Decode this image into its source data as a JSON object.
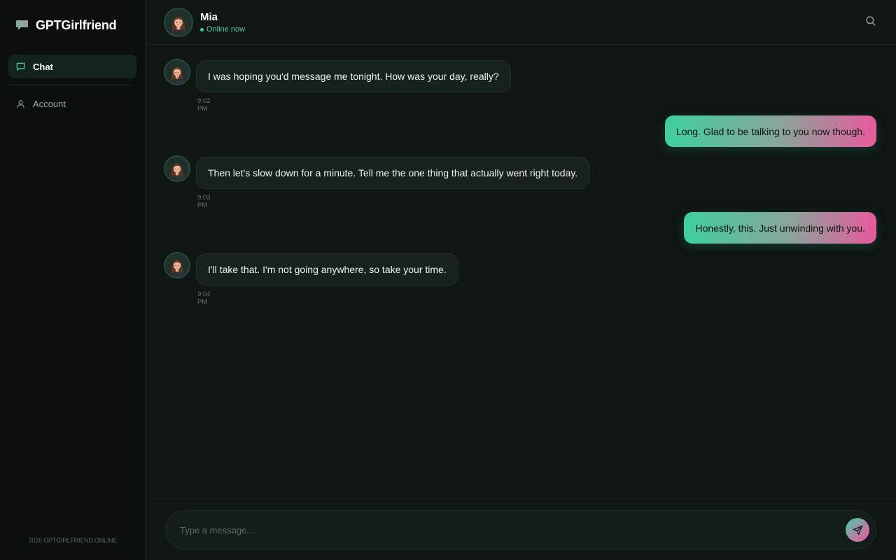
{
  "app": {
    "name": "GPTGirlfriend",
    "footer": "2026 GPTGIRLFRIEND.ONLINE"
  },
  "sidebar": {
    "items": [
      {
        "label": "Chat",
        "icon": "chat-bubble-icon",
        "active": true
      },
      {
        "label": "Account",
        "icon": "user-icon",
        "active": false
      }
    ]
  },
  "header": {
    "name": "Mia",
    "status": "Online now"
  },
  "messages": [
    {
      "from": "Mia",
      "text": "I was hoping you'd message me tonight. How was your day, really?",
      "time": "9:02 PM"
    },
    {
      "from": "me",
      "text": "Long. Glad to be talking to you now though."
    },
    {
      "from": "Mia",
      "text": "Then let's slow down for a minute. Tell me the one thing that actually went right today.",
      "time": "9:03 PM"
    },
    {
      "from": "me",
      "text": "Honestly, this. Just unwinding with you."
    },
    {
      "from": "Mia",
      "text": "I'll take that. I'm not going anywhere, so take your time.",
      "time": "9:04 PM"
    }
  ],
  "composer": {
    "placeholder": "Type a message..."
  },
  "colors": {
    "accent": "#3ecfa0",
    "accent_pink": "#e85a9c",
    "status_online": "#3fcf96",
    "background": "#0f1614",
    "sidebar_bg": "#0b100f"
  }
}
